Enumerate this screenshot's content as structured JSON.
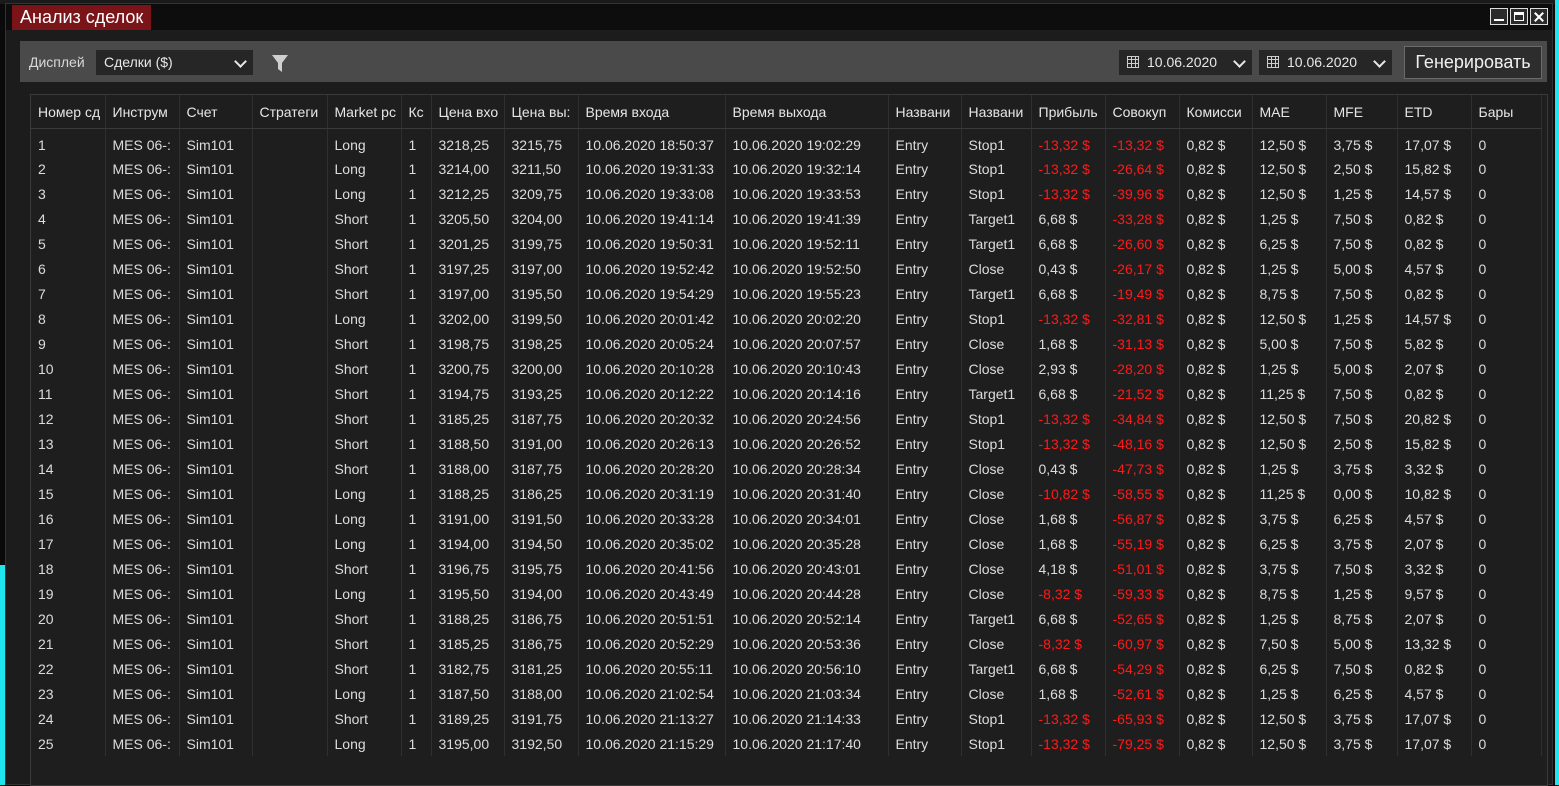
{
  "window": {
    "title": "Анализ сделок"
  },
  "toolbar": {
    "display_label": "Дисплей",
    "display_value": "Сделки ($)",
    "date_from": "10.06.2020",
    "date_to": "10.06.2020",
    "generate_label": "Генерировать"
  },
  "colors": {
    "negative": "#ff1a1a",
    "title_accent": "#7a1418"
  },
  "columns": [
    "Номер сд",
    "Инструм",
    "Счет",
    "Стратеги",
    "Market pc",
    "Кс",
    "Цена вхо",
    "Цена вы:",
    "Время входа",
    "Время выхода",
    "Названи",
    "Названи",
    "Прибыль",
    "Совокуп",
    "Комисси",
    "MAE",
    "MFE",
    "ETD",
    "Бары"
  ],
  "rows": [
    [
      "1",
      "MES 06-:",
      "Sim101",
      "",
      "Long",
      "1",
      "3218,25",
      "3215,75",
      "10.06.2020 18:50:37",
      "10.06.2020 19:02:29",
      "Entry",
      "Stop1",
      "-13,32 $",
      "-13,32 $",
      "0,82 $",
      "12,50 $",
      "3,75 $",
      "17,07 $",
      "0"
    ],
    [
      "2",
      "MES 06-:",
      "Sim101",
      "",
      "Long",
      "1",
      "3214,00",
      "3211,50",
      "10.06.2020 19:31:33",
      "10.06.2020 19:32:14",
      "Entry",
      "Stop1",
      "-13,32 $",
      "-26,64 $",
      "0,82 $",
      "12,50 $",
      "2,50 $",
      "15,82 $",
      "0"
    ],
    [
      "3",
      "MES 06-:",
      "Sim101",
      "",
      "Long",
      "1",
      "3212,25",
      "3209,75",
      "10.06.2020 19:33:08",
      "10.06.2020 19:33:53",
      "Entry",
      "Stop1",
      "-13,32 $",
      "-39,96 $",
      "0,82 $",
      "12,50 $",
      "1,25 $",
      "14,57 $",
      "0"
    ],
    [
      "4",
      "MES 06-:",
      "Sim101",
      "",
      "Short",
      "1",
      "3205,50",
      "3204,00",
      "10.06.2020 19:41:14",
      "10.06.2020 19:41:39",
      "Entry",
      "Target1",
      "6,68 $",
      "-33,28 $",
      "0,82 $",
      "1,25 $",
      "7,50 $",
      "0,82 $",
      "0"
    ],
    [
      "5",
      "MES 06-:",
      "Sim101",
      "",
      "Short",
      "1",
      "3201,25",
      "3199,75",
      "10.06.2020 19:50:31",
      "10.06.2020 19:52:11",
      "Entry",
      "Target1",
      "6,68 $",
      "-26,60 $",
      "0,82 $",
      "6,25 $",
      "7,50 $",
      "0,82 $",
      "0"
    ],
    [
      "6",
      "MES 06-:",
      "Sim101",
      "",
      "Short",
      "1",
      "3197,25",
      "3197,00",
      "10.06.2020 19:52:42",
      "10.06.2020 19:52:50",
      "Entry",
      "Close",
      "0,43 $",
      "-26,17 $",
      "0,82 $",
      "1,25 $",
      "5,00 $",
      "4,57 $",
      "0"
    ],
    [
      "7",
      "MES 06-:",
      "Sim101",
      "",
      "Short",
      "1",
      "3197,00",
      "3195,50",
      "10.06.2020 19:54:29",
      "10.06.2020 19:55:23",
      "Entry",
      "Target1",
      "6,68 $",
      "-19,49 $",
      "0,82 $",
      "8,75 $",
      "7,50 $",
      "0,82 $",
      "0"
    ],
    [
      "8",
      "MES 06-:",
      "Sim101",
      "",
      "Long",
      "1",
      "3202,00",
      "3199,50",
      "10.06.2020 20:01:42",
      "10.06.2020 20:02:20",
      "Entry",
      "Stop1",
      "-13,32 $",
      "-32,81 $",
      "0,82 $",
      "12,50 $",
      "1,25 $",
      "14,57 $",
      "0"
    ],
    [
      "9",
      "MES 06-:",
      "Sim101",
      "",
      "Short",
      "1",
      "3198,75",
      "3198,25",
      "10.06.2020 20:05:24",
      "10.06.2020 20:07:57",
      "Entry",
      "Close",
      "1,68 $",
      "-31,13 $",
      "0,82 $",
      "5,00 $",
      "7,50 $",
      "5,82 $",
      "0"
    ],
    [
      "10",
      "MES 06-:",
      "Sim101",
      "",
      "Short",
      "1",
      "3200,75",
      "3200,00",
      "10.06.2020 20:10:28",
      "10.06.2020 20:10:43",
      "Entry",
      "Close",
      "2,93 $",
      "-28,20 $",
      "0,82 $",
      "1,25 $",
      "5,00 $",
      "2,07 $",
      "0"
    ],
    [
      "11",
      "MES 06-:",
      "Sim101",
      "",
      "Short",
      "1",
      "3194,75",
      "3193,25",
      "10.06.2020 20:12:22",
      "10.06.2020 20:14:16",
      "Entry",
      "Target1",
      "6,68 $",
      "-21,52 $",
      "0,82 $",
      "11,25 $",
      "7,50 $",
      "0,82 $",
      "0"
    ],
    [
      "12",
      "MES 06-:",
      "Sim101",
      "",
      "Short",
      "1",
      "3185,25",
      "3187,75",
      "10.06.2020 20:20:32",
      "10.06.2020 20:24:56",
      "Entry",
      "Stop1",
      "-13,32 $",
      "-34,84 $",
      "0,82 $",
      "12,50 $",
      "7,50 $",
      "20,82 $",
      "0"
    ],
    [
      "13",
      "MES 06-:",
      "Sim101",
      "",
      "Short",
      "1",
      "3188,50",
      "3191,00",
      "10.06.2020 20:26:13",
      "10.06.2020 20:26:52",
      "Entry",
      "Stop1",
      "-13,32 $",
      "-48,16 $",
      "0,82 $",
      "12,50 $",
      "2,50 $",
      "15,82 $",
      "0"
    ],
    [
      "14",
      "MES 06-:",
      "Sim101",
      "",
      "Short",
      "1",
      "3188,00",
      "3187,75",
      "10.06.2020 20:28:20",
      "10.06.2020 20:28:34",
      "Entry",
      "Close",
      "0,43 $",
      "-47,73 $",
      "0,82 $",
      "1,25 $",
      "3,75 $",
      "3,32 $",
      "0"
    ],
    [
      "15",
      "MES 06-:",
      "Sim101",
      "",
      "Long",
      "1",
      "3188,25",
      "3186,25",
      "10.06.2020 20:31:19",
      "10.06.2020 20:31:40",
      "Entry",
      "Close",
      "-10,82 $",
      "-58,55 $",
      "0,82 $",
      "11,25 $",
      "0,00 $",
      "10,82 $",
      "0"
    ],
    [
      "16",
      "MES 06-:",
      "Sim101",
      "",
      "Long",
      "1",
      "3191,00",
      "3191,50",
      "10.06.2020 20:33:28",
      "10.06.2020 20:34:01",
      "Entry",
      "Close",
      "1,68 $",
      "-56,87 $",
      "0,82 $",
      "3,75 $",
      "6,25 $",
      "4,57 $",
      "0"
    ],
    [
      "17",
      "MES 06-:",
      "Sim101",
      "",
      "Long",
      "1",
      "3194,00",
      "3194,50",
      "10.06.2020 20:35:02",
      "10.06.2020 20:35:28",
      "Entry",
      "Close",
      "1,68 $",
      "-55,19 $",
      "0,82 $",
      "6,25 $",
      "3,75 $",
      "2,07 $",
      "0"
    ],
    [
      "18",
      "MES 06-:",
      "Sim101",
      "",
      "Short",
      "1",
      "3196,75",
      "3195,75",
      "10.06.2020 20:41:56",
      "10.06.2020 20:43:01",
      "Entry",
      "Close",
      "4,18 $",
      "-51,01 $",
      "0,82 $",
      "3,75 $",
      "7,50 $",
      "3,32 $",
      "0"
    ],
    [
      "19",
      "MES 06-:",
      "Sim101",
      "",
      "Long",
      "1",
      "3195,50",
      "3194,00",
      "10.06.2020 20:43:49",
      "10.06.2020 20:44:28",
      "Entry",
      "Close",
      "-8,32 $",
      "-59,33 $",
      "0,82 $",
      "8,75 $",
      "1,25 $",
      "9,57 $",
      "0"
    ],
    [
      "20",
      "MES 06-:",
      "Sim101",
      "",
      "Short",
      "1",
      "3188,25",
      "3186,75",
      "10.06.2020 20:51:51",
      "10.06.2020 20:52:14",
      "Entry",
      "Target1",
      "6,68 $",
      "-52,65 $",
      "0,82 $",
      "1,25 $",
      "8,75 $",
      "2,07 $",
      "0"
    ],
    [
      "21",
      "MES 06-:",
      "Sim101",
      "",
      "Short",
      "1",
      "3185,25",
      "3186,75",
      "10.06.2020 20:52:29",
      "10.06.2020 20:53:36",
      "Entry",
      "Close",
      "-8,32 $",
      "-60,97 $",
      "0,82 $",
      "7,50 $",
      "5,00 $",
      "13,32 $",
      "0"
    ],
    [
      "22",
      "MES 06-:",
      "Sim101",
      "",
      "Short",
      "1",
      "3182,75",
      "3181,25",
      "10.06.2020 20:55:11",
      "10.06.2020 20:56:10",
      "Entry",
      "Target1",
      "6,68 $",
      "-54,29 $",
      "0,82 $",
      "6,25 $",
      "7,50 $",
      "0,82 $",
      "0"
    ],
    [
      "23",
      "MES 06-:",
      "Sim101",
      "",
      "Long",
      "1",
      "3187,50",
      "3188,00",
      "10.06.2020 21:02:54",
      "10.06.2020 21:03:34",
      "Entry",
      "Close",
      "1,68 $",
      "-52,61 $",
      "0,82 $",
      "1,25 $",
      "6,25 $",
      "4,57 $",
      "0"
    ],
    [
      "24",
      "MES 06-:",
      "Sim101",
      "",
      "Short",
      "1",
      "3189,25",
      "3191,75",
      "10.06.2020 21:13:27",
      "10.06.2020 21:14:33",
      "Entry",
      "Stop1",
      "-13,32 $",
      "-65,93 $",
      "0,82 $",
      "12,50 $",
      "3,75 $",
      "17,07 $",
      "0"
    ],
    [
      "25",
      "MES 06-:",
      "Sim101",
      "",
      "Long",
      "1",
      "3195,00",
      "3192,50",
      "10.06.2020 21:15:29",
      "10.06.2020 21:17:40",
      "Entry",
      "Stop1",
      "-13,32 $",
      "-79,25 $",
      "0,82 $",
      "12,50 $",
      "3,75 $",
      "17,07 $",
      "0"
    ]
  ]
}
